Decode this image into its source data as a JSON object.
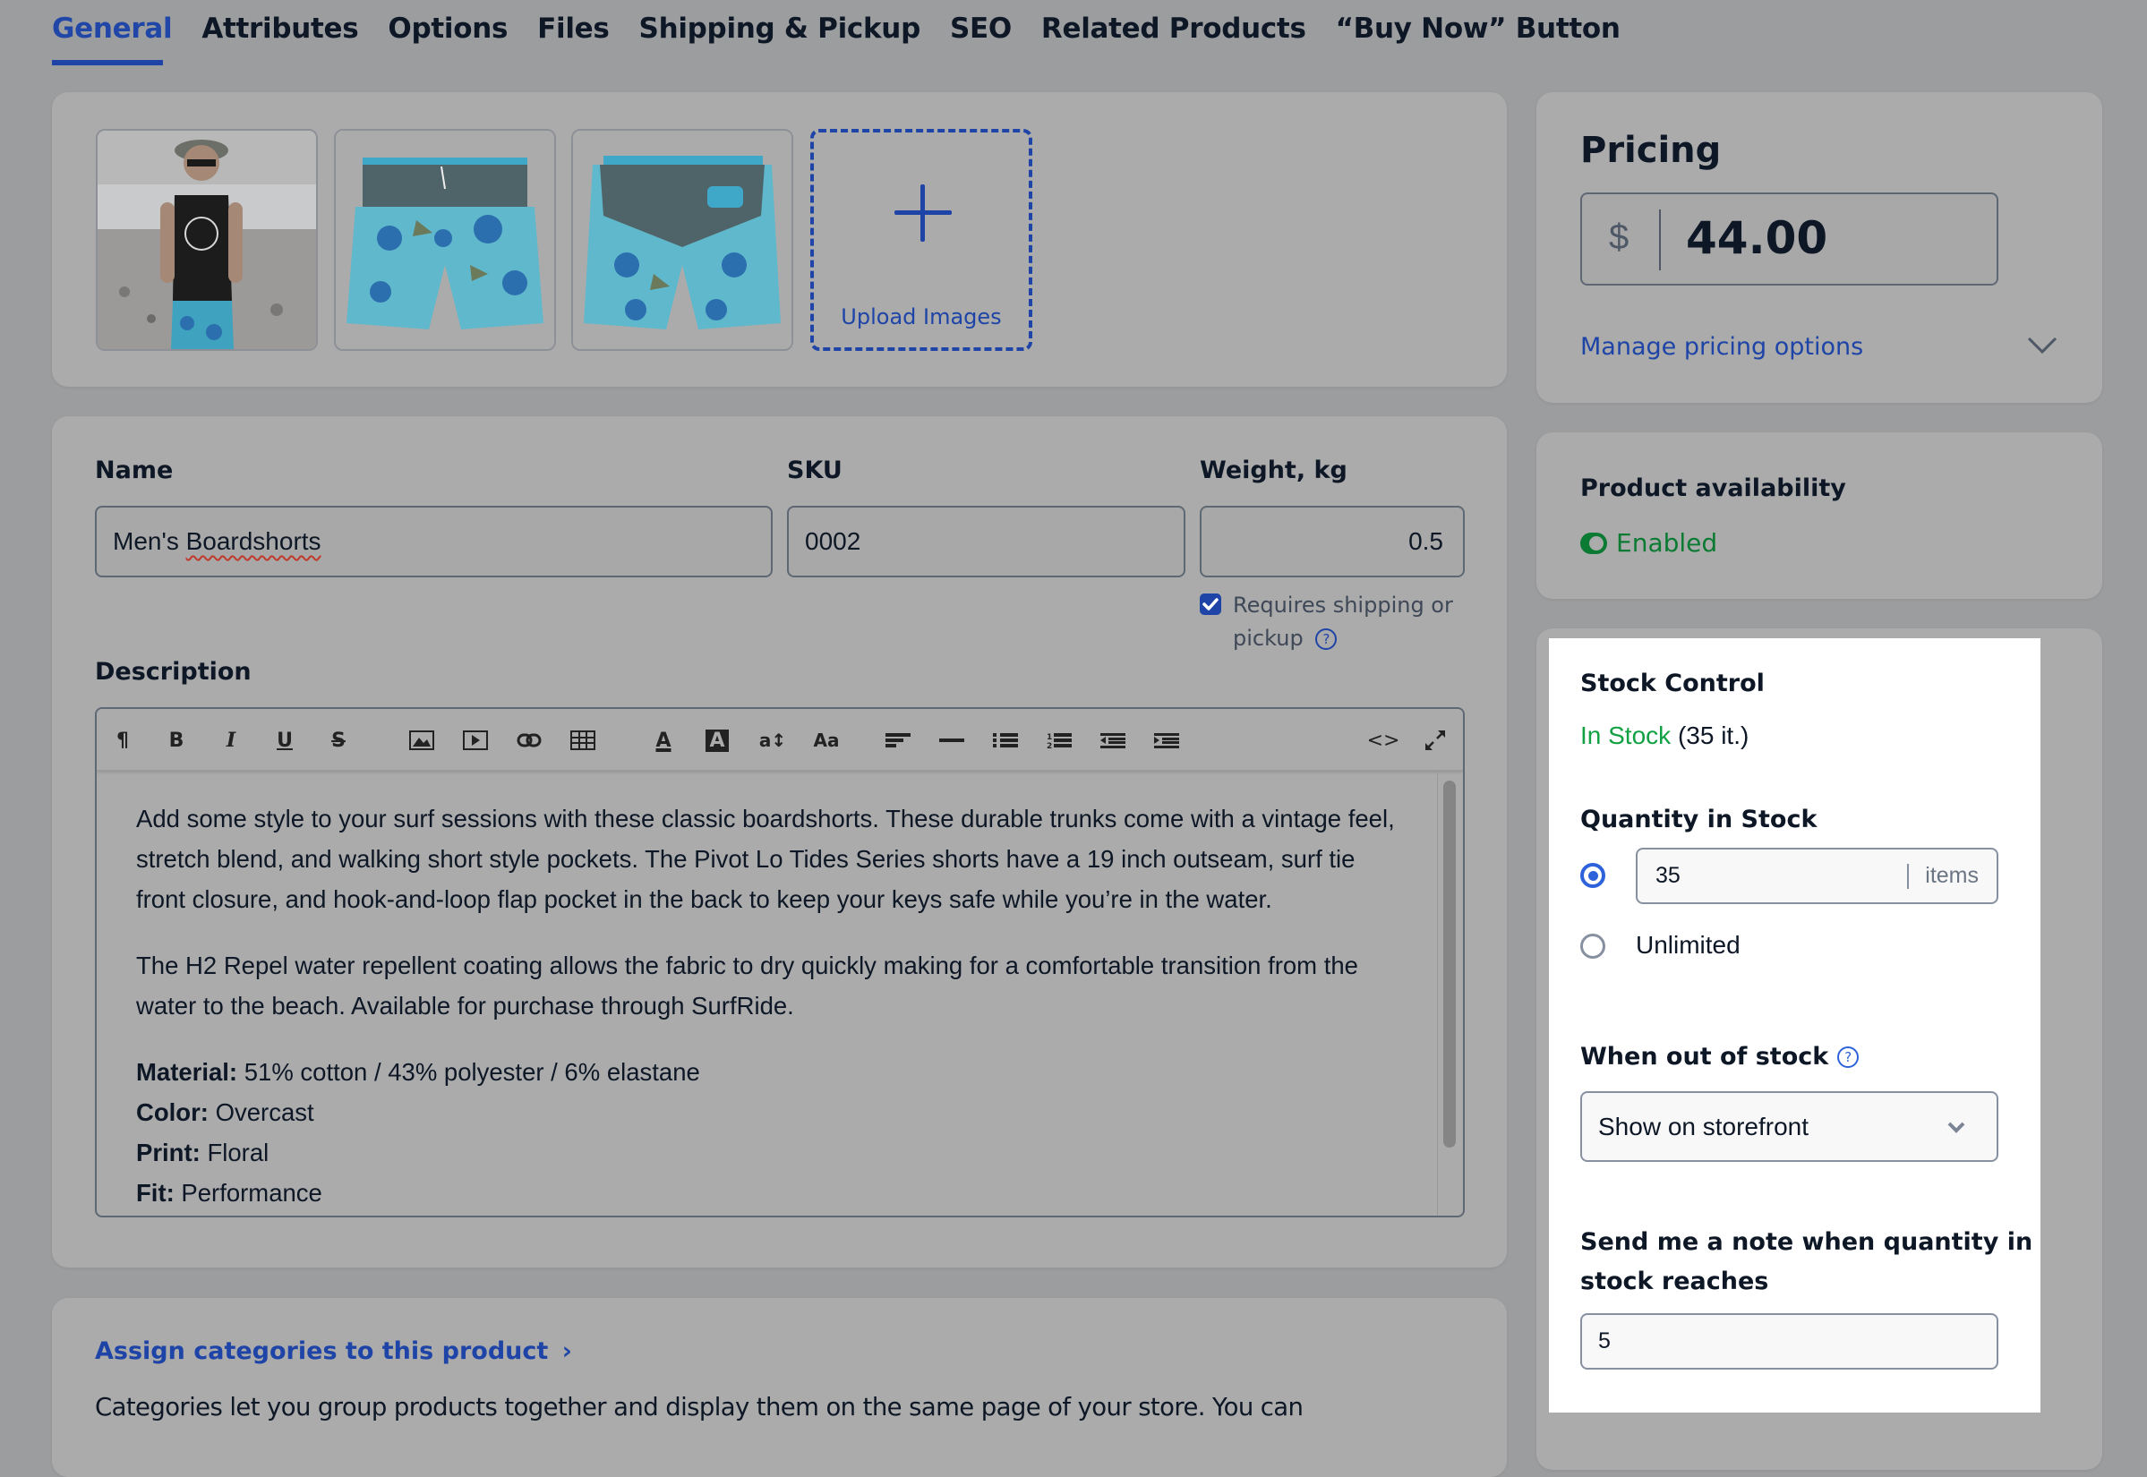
{
  "tabs": [
    {
      "label": "General",
      "active": true
    },
    {
      "label": "Attributes"
    },
    {
      "label": "Options"
    },
    {
      "label": "Files"
    },
    {
      "label": "Shipping & Pickup"
    },
    {
      "label": "SEO"
    },
    {
      "label": "Related Products"
    },
    {
      "label": "“Buy Now” Button"
    }
  ],
  "images": {
    "thumbnails": [
      {
        "alt": "Man on beach wearing boardshorts"
      },
      {
        "alt": "Boardshorts front view"
      },
      {
        "alt": "Boardshorts back view"
      }
    ],
    "upload_label": "Upload Images",
    "upload_icon": "plus-icon"
  },
  "product": {
    "name_label": "Name",
    "name_value": "Men's Boardshorts",
    "sku_label": "SKU",
    "sku_value": "0002",
    "weight_label": "Weight, kg",
    "weight_value": "0.5",
    "requires_shipping_label_1": "Requires shipping or",
    "requires_shipping_label_2": "pickup",
    "requires_shipping_checked": true,
    "description_label": "Description"
  },
  "editor": {
    "toolbar": [
      {
        "icon": "paragraph-icon",
        "glyph": "¶"
      },
      {
        "icon": "bold-icon",
        "glyph": "B"
      },
      {
        "icon": "italic-icon",
        "glyph": "I"
      },
      {
        "icon": "underline-icon",
        "glyph": "U"
      },
      {
        "icon": "strikethrough-icon",
        "glyph": "S"
      },
      {
        "icon": "image-icon",
        "glyph": "▲"
      },
      {
        "icon": "video-icon",
        "glyph": "▶"
      },
      {
        "icon": "link-icon",
        "glyph": "⊂⊃"
      },
      {
        "icon": "table-icon",
        "glyph": "▦"
      },
      {
        "icon": "font-color-icon",
        "glyph": "A"
      },
      {
        "icon": "highlight-color-icon",
        "glyph": "A"
      },
      {
        "icon": "font-size-icon",
        "glyph": "a↕"
      },
      {
        "icon": "font-family-icon",
        "glyph": "Aa"
      },
      {
        "icon": "align-left-icon",
        "glyph": "≡"
      },
      {
        "icon": "horizontal-rule-icon",
        "glyph": "—"
      },
      {
        "icon": "bullet-list-icon",
        "glyph": "☰"
      },
      {
        "icon": "numbered-list-icon",
        "glyph": "☰"
      },
      {
        "icon": "outdent-icon",
        "glyph": "☰"
      },
      {
        "icon": "indent-icon",
        "glyph": "☰"
      },
      {
        "icon": "code-view-icon",
        "glyph": "<>"
      },
      {
        "icon": "fullscreen-icon",
        "glyph": "⤢"
      }
    ],
    "paragraphs": [
      "Add some style to your surf sessions with these classic boardshorts. These durable trunks come with a vintage feel, stretch blend, and walking short style pockets. The Pivot Lo Tides Series shorts have a 19 inch outseam, surf tie front closure, and hook-and-loop flap pocket in the back to keep your keys safe while you’re in the water.",
      "The H2 Repel water repellent coating allows the fabric to dry quickly making for a comfortable transition from the water to the beach. Available for purchase through SurfRide."
    ],
    "specs": [
      {
        "key": "Material:",
        "value": " 51% cotton / 43% polyester / 6% elastane"
      },
      {
        "key": "Color:",
        "value": " Overcast"
      },
      {
        "key": "Print:",
        "value": " Floral"
      },
      {
        "key": "Fit:",
        "value": " Performance"
      }
    ]
  },
  "categories": {
    "link_label": "Assign categories to this product",
    "description": "Categories let you group products together and display them on the same page of your store. You can"
  },
  "pricing": {
    "title": "Pricing",
    "currency": "$",
    "price": "44.00",
    "manage_label": "Manage pricing options"
  },
  "availability": {
    "title": "Product availability",
    "status": "Enabled"
  },
  "stock": {
    "title": "Stock Control",
    "status": "In Stock",
    "status_count": "(35 it.)",
    "quantity_label": "Quantity in Stock",
    "quantity_value": "35",
    "quantity_unit": "items",
    "quantity_selected": "limited",
    "unlimited_label": "Unlimited",
    "out_of_stock_label": "When out of stock",
    "out_of_stock_value": "Show on storefront",
    "notify_label_1": "Send me a note when quantity in",
    "notify_label_2": "stock reaches",
    "notify_value": "5"
  },
  "colors": {
    "accent": "#1d44a6",
    "success": "#0b7a32",
    "in_stock": "#12a142",
    "radio": "#2d62db"
  }
}
